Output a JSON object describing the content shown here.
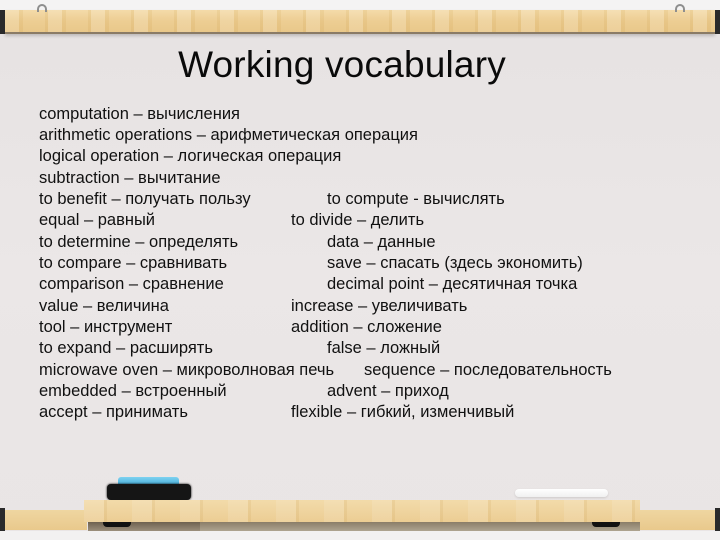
{
  "slide": {
    "title": "Working vocabulary"
  },
  "vocabulary": {
    "rows": [
      {
        "left": "computation – вычисления",
        "right": ""
      },
      {
        "left": "arithmetic operations – арифметическая операция",
        "right": ""
      },
      {
        "left": "logical operation – логическая операция",
        "right": ""
      },
      {
        "left": "subtraction – вычитание",
        "right": ""
      },
      {
        "left": "to benefit – получать пользу",
        "right": "to compute - вычислять"
      },
      {
        "left": "equal – равный",
        "right": "to divide – делить"
      },
      {
        "left": "to determine – определять",
        "right": "data – данные"
      },
      {
        "left": "to compare – сравнивать",
        "right": "save – спасать (здесь экономить)"
      },
      {
        "left": "comparison – сравнение",
        "right": "decimal point – десятичная точка"
      },
      {
        "left": "value – величина",
        "right": "increase – увеличивать"
      },
      {
        "left": "tool – инструмент",
        "right": "addition – сложение"
      },
      {
        "left": "to expand – расширять",
        "right": "false – ложный"
      },
      {
        "left": "microwave oven – микроволновая печь",
        "right": "sequence – последовательность"
      },
      {
        "left": "embedded – встроенный",
        "right": "advent – приход"
      },
      {
        "left": "accept – принимать",
        "right": "flexible – гибкий, изменчивый"
      }
    ]
  },
  "decor": {
    "board_color": "#e9e5e5",
    "wood_color": "#ecca8d",
    "eraser_color": "#3aa6d6",
    "marker_color": "#ffffff"
  }
}
